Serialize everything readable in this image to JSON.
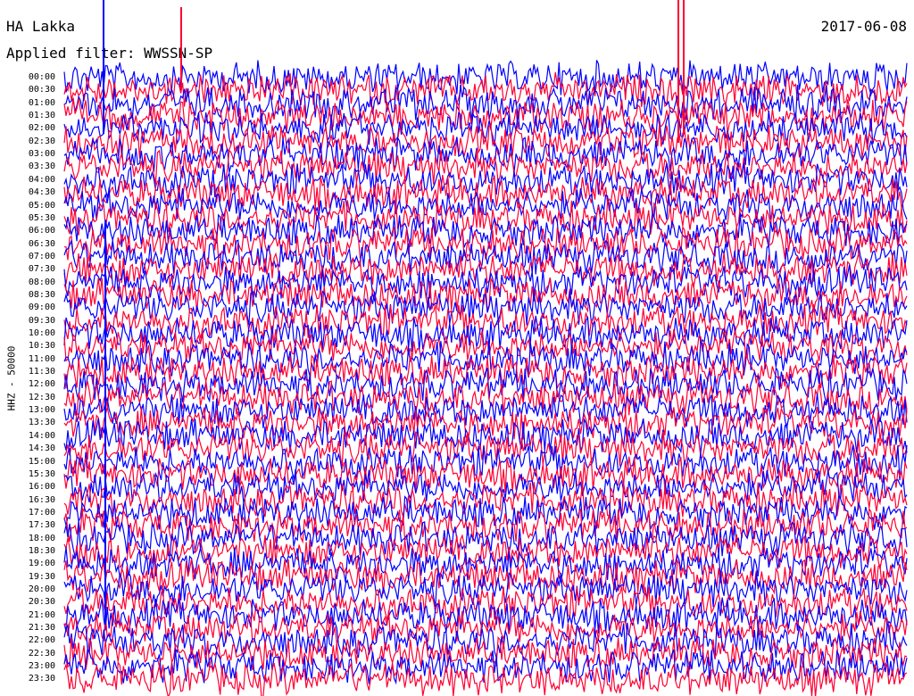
{
  "header": {
    "station": "HA Lakka",
    "date": "2017-06-08",
    "filter": "Applied filter: WWSSN-SP"
  },
  "chart_data": {
    "type": "line",
    "title": "HA Lakka",
    "ylabel": "HHZ - 50000",
    "xlabel": "",
    "time_labels": [
      "00:00",
      "00:30",
      "01:00",
      "01:30",
      "02:00",
      "02:30",
      "03:00",
      "03:30",
      "04:00",
      "04:30",
      "05:00",
      "05:30",
      "06:00",
      "06:30",
      "07:00",
      "07:30",
      "08:00",
      "08:30",
      "09:00",
      "09:30",
      "10:00",
      "10:30",
      "11:00",
      "11:30",
      "12:00",
      "12:30",
      "13:00",
      "13:30",
      "14:00",
      "14:30",
      "15:00",
      "15:30",
      "16:00",
      "16:30",
      "17:00",
      "17:30",
      "18:00",
      "18:30",
      "19:00",
      "19:30",
      "20:00",
      "20:30",
      "21:00",
      "21:30",
      "22:00",
      "22:30",
      "23:00",
      "23:30"
    ],
    "series_colors": [
      "#0000ff",
      "#ff0033"
    ],
    "grid": false,
    "legend": "none"
  }
}
